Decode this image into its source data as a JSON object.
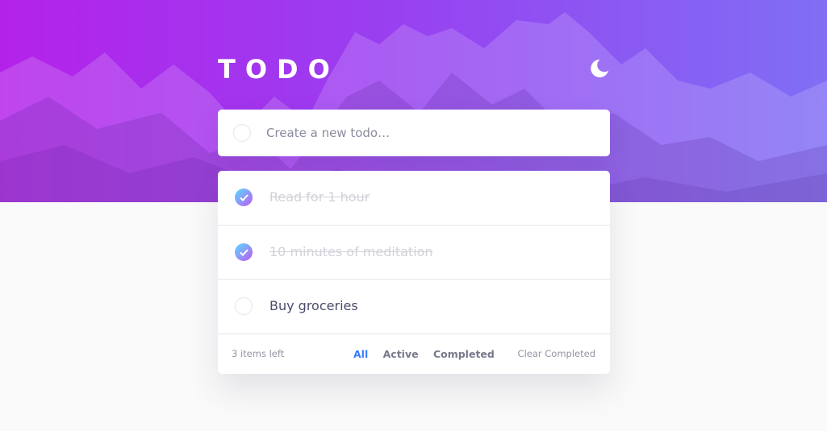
{
  "header": {
    "title": "TODO",
    "theme_icon": "moon-icon"
  },
  "new_todo": {
    "placeholder": "Create a new todo…",
    "value": ""
  },
  "todos": [
    {
      "text": "Read for 1 hour",
      "completed": true
    },
    {
      "text": "10 minutes of meditation",
      "completed": true
    },
    {
      "text": "Buy groceries",
      "completed": false
    }
  ],
  "footer": {
    "items_left": "3 items left",
    "filters": [
      {
        "label": "All",
        "active": true
      },
      {
        "label": "Active",
        "active": false
      },
      {
        "label": "Completed",
        "active": false
      }
    ],
    "clear_label": "Clear Completed"
  },
  "colors": {
    "accent": "#3a7cfd",
    "check_gradient_start": "#57ddff",
    "check_gradient_end": "#c058f3",
    "hero_gradient_start": "#b422ea",
    "hero_gradient_end": "#7f6ff5"
  }
}
